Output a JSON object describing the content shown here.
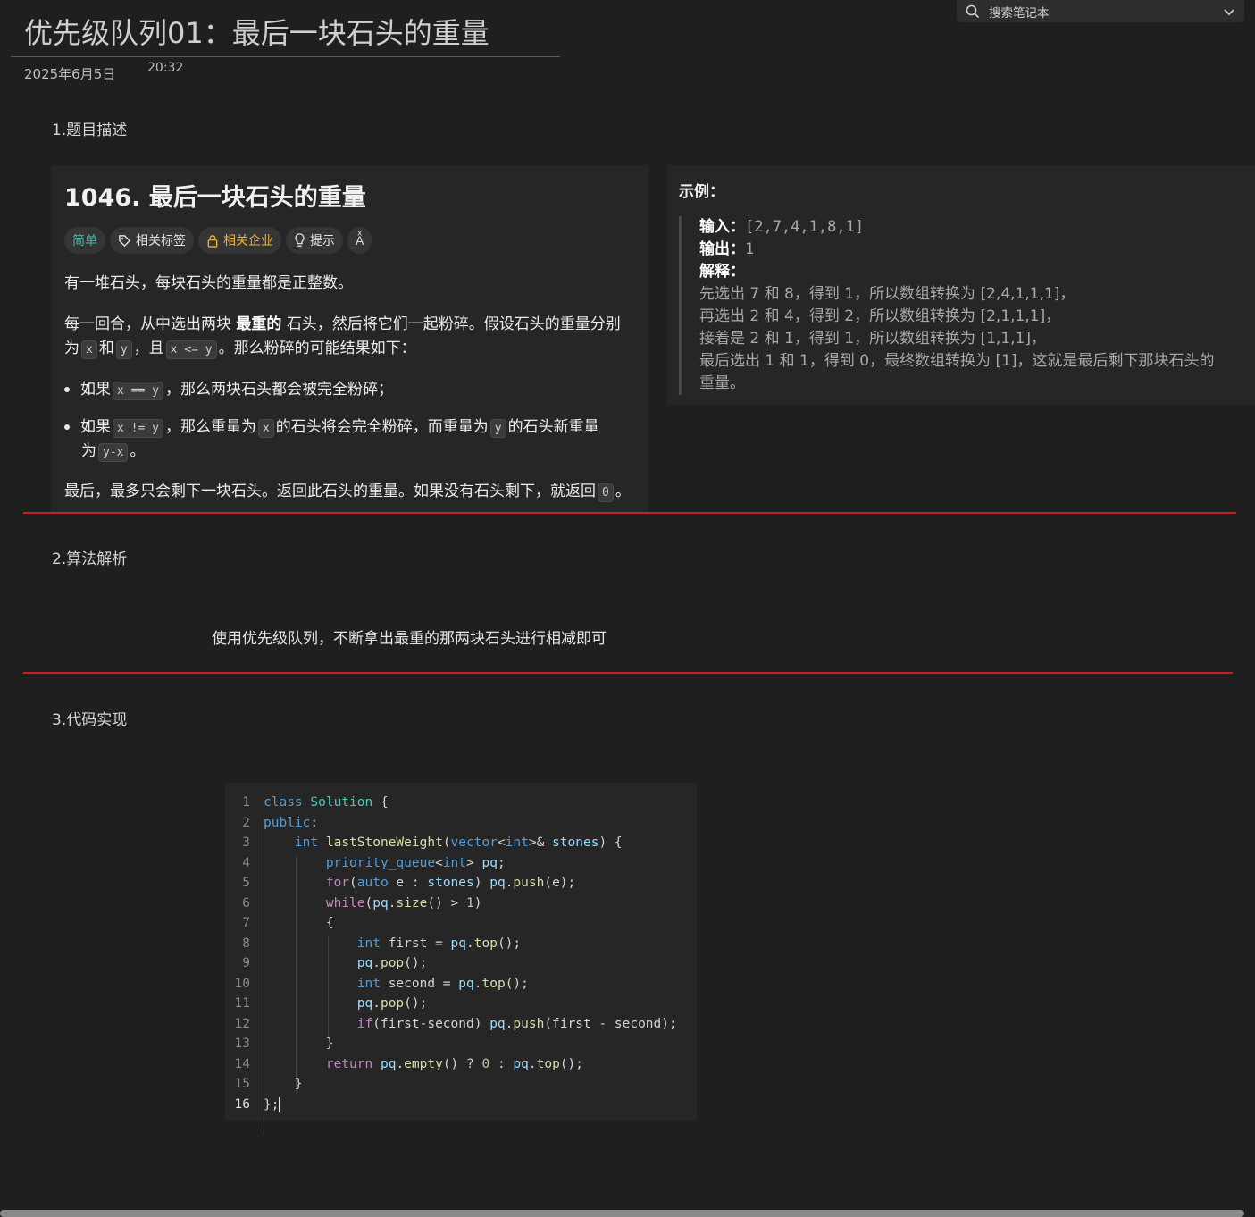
{
  "page": {
    "title": "优先级队列01：最后一块石头的重量",
    "date": "2025年6月5日",
    "time": "20:32"
  },
  "search": {
    "placeholder": "搜索笔记本"
  },
  "sections": {
    "s1": "1.题目描述",
    "s2": "2.算法解析",
    "s3": "3.代码实现"
  },
  "problem": {
    "title": "1046. 最后一块石头的重量",
    "tags": {
      "difficulty": "简单",
      "related_tags": "相关标签",
      "related_companies": "相关企业",
      "hint": "提示",
      "translate": "Aͯ"
    },
    "p1": "有一堆石头，每块石头的重量都是正整数。",
    "p2": {
      "a": "每一回合，从中选出两块",
      "b": "最重的",
      "c": "石头，然后将它们一起粉碎。假设石头的重量分别",
      "d": "为",
      "x": "x",
      "e": "和",
      "y": "y",
      "f": "，且",
      "xy": "x <= y",
      "g": "。那么粉碎的可能结果如下："
    },
    "b1": {
      "a": "如果",
      "code": "x == y",
      "b": "，那么两块石头都会被完全粉碎；"
    },
    "b2": {
      "a": "如果",
      "code": "x != y",
      "b": "，那么重量为",
      "x": "x",
      "c": "的石头将会完全粉碎，而重量为",
      "y": "y",
      "d": "的石头新重量",
      "e": "为",
      "yx": "y-x",
      "f": "。"
    },
    "p3": {
      "a": "最后，最多只会剩下一块石头。返回此石头的重量。如果没有石头剩下，就返回",
      "zero": "0",
      "b": "。"
    }
  },
  "example": {
    "title": "示例：",
    "input_label": "输入：",
    "input_value": "[2,7,4,1,8,1]",
    "output_label": "输出：",
    "output_value": "1",
    "explain_label": "解释：",
    "lines": [
      "先选出 7 和 8，得到 1，所以数组转换为 [2,4,1,1,1]，",
      "再选出 2 和 4，得到 2，所以数组转换为 [2,1,1,1]，",
      "接着是 2 和 1，得到 1，所以数组转换为 [1,1,1]，",
      "最后选出 1 和 1，得到 0，最终数组转换为 [1]，这就是最后剩下那块石头的",
      "重量。"
    ]
  },
  "analysis": "使用优先级队列，不断拿出最重的那两块石头进行相减即可",
  "code": {
    "line_numbers": [
      "1",
      "2",
      "3",
      "4",
      "5",
      "6",
      "7",
      "8",
      "9",
      "10",
      "11",
      "12",
      "13",
      "14",
      "15",
      "16"
    ],
    "lines": [
      "class Solution {",
      "public:",
      "    int lastStoneWeight(vector<int>& stones) {",
      "        priority_queue<int> pq;",
      "        for(auto e : stones) pq.push(e);",
      "        while(pq.size() > 1)",
      "        {",
      "            int first = pq.top();",
      "            pq.pop();",
      "            int second = pq.top();",
      "            pq.pop();",
      "            if(first-second) pq.push(first - second);",
      "        }",
      "        return pq.empty() ? 0 : pq.top();",
      "    }",
      "};"
    ]
  },
  "colors": {
    "accent_red": "#c8202a",
    "easy": "#45b7a6",
    "company": "#f0b030",
    "background": "#1f1f1f"
  }
}
